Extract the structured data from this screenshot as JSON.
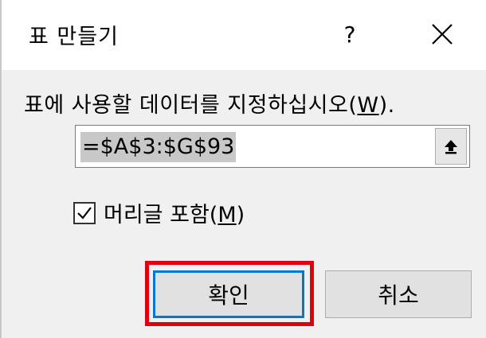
{
  "dialog": {
    "title": "표 만들기",
    "help_label": "?",
    "close_icon": "close-icon"
  },
  "prompt": {
    "text": "표에 사용할 데이터를 지정하십시오",
    "accel_prefix": "(",
    "accel_key": "W",
    "accel_suffix": ")."
  },
  "range": {
    "value": "=$A$3:$G$93",
    "collapse_icon": "collapse-dialog-icon"
  },
  "header_option": {
    "checked": true,
    "label": "머리글 포함",
    "accel_prefix": "(",
    "accel_key": "M",
    "accel_suffix": ")"
  },
  "buttons": {
    "ok_label": "확인",
    "cancel_label": "취소"
  },
  "colors": {
    "highlight": "#e0000f",
    "focus_border": "#0078d7",
    "dialog_background": "#f0f0f0"
  }
}
